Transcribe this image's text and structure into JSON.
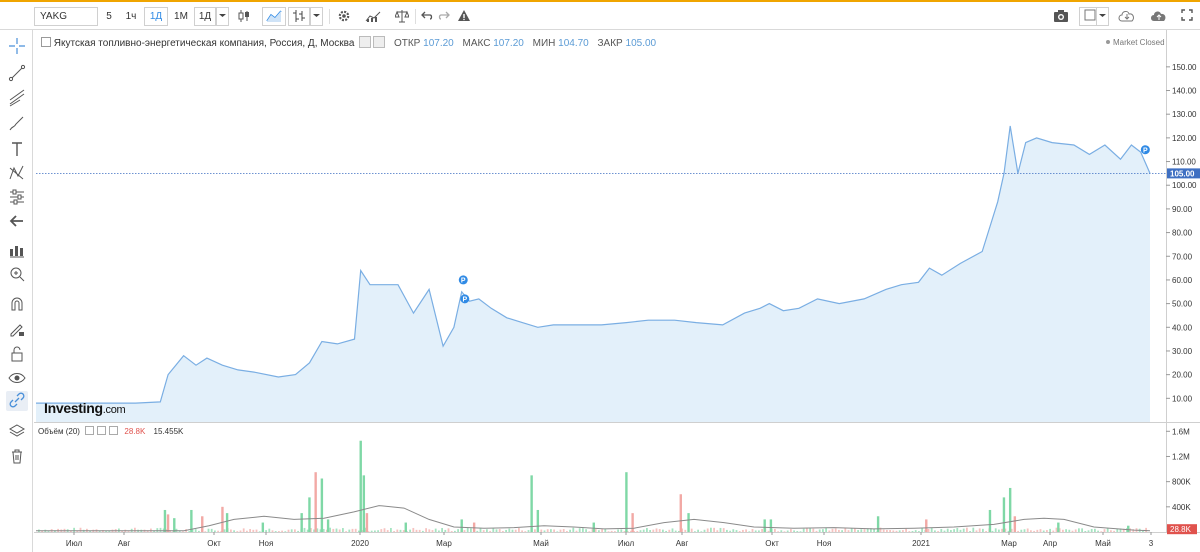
{
  "toolbar": {
    "symbol": "YAKG",
    "intervals": [
      "5",
      "1ч",
      "1Д",
      "1М",
      "1Д"
    ],
    "active_interval": 2
  },
  "legend": {
    "title": "Якутская топливно-энергетическая компания, Россия, Д, Москва",
    "open_label": "ОТКР",
    "open": "107.20",
    "high_label": "МАКС",
    "high": "107.20",
    "low_label": "МИН",
    "low": "104.70",
    "close_label": "ЗАКР",
    "close": "105.00",
    "market_status": "Market Closed"
  },
  "volume_legend": {
    "label": "Объём (20)",
    "last_volume": "28.8K",
    "ma_value": "15.455K"
  },
  "watermark": {
    "brand": "Investing",
    "suffix": ".com"
  },
  "colors": {
    "price_line": "#7aaee3",
    "price_fill": "#e3f0fa",
    "vol_up": "#7fd8a6",
    "vol_down": "#f2a9a5",
    "vol_ma": "#8a8a8a",
    "last_price_tag": "#3e6fc2",
    "last_volume_tag": "#e0524d"
  },
  "chart_data": [
    {
      "type": "area",
      "series": "price",
      "x": [
        "2019-06-17",
        "2019-07-01",
        "2019-07-15",
        "2019-08-01",
        "2019-08-20",
        "2019-09-05",
        "2019-09-10",
        "2019-09-20",
        "2019-09-28",
        "2019-10-05",
        "2019-10-15",
        "2019-10-25",
        "2019-11-05",
        "2019-11-20",
        "2019-12-01",
        "2019-12-10",
        "2019-12-18",
        "2019-12-28",
        "2020-01-08",
        "2020-01-12",
        "2020-01-18",
        "2020-01-25",
        "2020-02-05",
        "2020-02-15",
        "2020-02-25",
        "2020-03-05",
        "2020-03-12",
        "2020-03-17",
        "2020-03-22",
        "2020-03-28",
        "2020-04-05",
        "2020-04-15",
        "2020-04-25",
        "2020-05-05",
        "2020-05-15",
        "2020-05-28",
        "2020-06-15",
        "2020-07-01",
        "2020-07-15",
        "2020-08-01",
        "2020-08-15",
        "2020-09-01",
        "2020-09-15",
        "2020-09-25",
        "2020-10-01",
        "2020-10-10",
        "2020-10-20",
        "2020-11-01",
        "2020-11-15",
        "2020-12-01",
        "2020-12-15",
        "2020-12-25",
        "2021-01-05",
        "2021-01-12",
        "2021-01-20",
        "2021-02-01",
        "2021-02-15",
        "2021-02-25",
        "2021-03-01",
        "2021-03-05",
        "2021-03-10",
        "2021-03-15",
        "2021-03-22",
        "2021-04-01",
        "2021-04-15",
        "2021-04-25",
        "2021-05-05",
        "2021-05-15",
        "2021-05-22",
        "2021-05-28",
        "2021-06-01",
        "2021-06-03"
      ],
      "y": [
        8,
        8,
        8,
        8,
        8,
        8.5,
        20,
        28,
        24,
        27,
        24,
        22,
        21,
        19,
        20,
        25,
        34,
        33,
        35,
        64,
        58,
        58,
        58,
        46,
        56,
        32,
        40,
        55,
        51,
        52,
        48,
        44,
        42,
        40,
        41,
        41,
        41,
        42,
        43,
        43,
        42,
        41,
        46,
        48,
        50,
        47,
        48,
        52,
        50,
        52,
        56,
        58,
        59,
        65,
        62,
        67,
        72,
        93,
        105,
        125,
        105,
        118,
        120,
        118,
        117,
        113,
        117,
        111,
        117,
        114,
        108,
        105
      ],
      "ylim": [
        0,
        155
      ],
      "y_ticks": [
        "10.00",
        "20.00",
        "30.00",
        "40.00",
        "50.00",
        "60.00",
        "70.00",
        "80.00",
        "90.00",
        "100.00",
        "110.00",
        "120.00",
        "130.00",
        "140.00",
        "150.00"
      ],
      "last_price": "105.00",
      "x_ticks": [
        "Июл",
        "Авг",
        "Окт",
        "Ноя",
        "2020",
        "Мар",
        "Май",
        "Июл",
        "Авг",
        "Окт",
        "Ноя",
        "2021",
        "Мар",
        "Апр",
        "Май",
        "3"
      ],
      "markers": [
        {
          "x": "2020-03-18",
          "y": 60,
          "label": "P"
        },
        {
          "x": "2020-03-19",
          "y": 52,
          "label": "P"
        },
        {
          "x": "2021-05-31",
          "y": 115,
          "label": "P"
        }
      ]
    },
    {
      "type": "bar",
      "series": "volume",
      "ylim": [
        0,
        1.7
      ],
      "y_unit": "M",
      "y_ticks": [
        "400K",
        "800K",
        "1.2M",
        "1.6M"
      ],
      "last_volume": "28.8K",
      "bars": [
        {
          "x": "2019-09-08",
          "v": 0.35,
          "up": true
        },
        {
          "x": "2019-09-10",
          "v": 0.28,
          "up": false
        },
        {
          "x": "2019-09-14",
          "v": 0.22,
          "up": true
        },
        {
          "x": "2019-09-25",
          "v": 0.35,
          "up": true
        },
        {
          "x": "2019-10-02",
          "v": 0.25,
          "up": false
        },
        {
          "x": "2019-10-15",
          "v": 0.4,
          "up": false
        },
        {
          "x": "2019-10-18",
          "v": 0.3,
          "up": true
        },
        {
          "x": "2019-11-10",
          "v": 0.15,
          "up": true
        },
        {
          "x": "2019-12-05",
          "v": 0.3,
          "up": true
        },
        {
          "x": "2019-12-10",
          "v": 0.55,
          "up": true
        },
        {
          "x": "2019-12-14",
          "v": 0.95,
          "up": false
        },
        {
          "x": "2019-12-18",
          "v": 0.85,
          "up": true
        },
        {
          "x": "2019-12-22",
          "v": 0.2,
          "up": true
        },
        {
          "x": "2020-01-12",
          "v": 1.45,
          "up": true
        },
        {
          "x": "2020-01-14",
          "v": 0.9,
          "up": true
        },
        {
          "x": "2020-01-16",
          "v": 0.3,
          "up": false
        },
        {
          "x": "2020-02-10",
          "v": 0.15,
          "up": true
        },
        {
          "x": "2020-03-17",
          "v": 0.2,
          "up": true
        },
        {
          "x": "2020-03-25",
          "v": 0.15,
          "up": false
        },
        {
          "x": "2020-05-01",
          "v": 0.9,
          "up": true
        },
        {
          "x": "2020-05-05",
          "v": 0.35,
          "up": true
        },
        {
          "x": "2020-06-10",
          "v": 0.15,
          "up": true
        },
        {
          "x": "2020-07-01",
          "v": 0.95,
          "up": true
        },
        {
          "x": "2020-07-05",
          "v": 0.3,
          "up": false
        },
        {
          "x": "2020-08-05",
          "v": 0.6,
          "up": false
        },
        {
          "x": "2020-08-10",
          "v": 0.3,
          "up": true
        },
        {
          "x": "2020-09-28",
          "v": 0.2,
          "up": true
        },
        {
          "x": "2020-10-02",
          "v": 0.2,
          "up": true
        },
        {
          "x": "2020-12-10",
          "v": 0.25,
          "up": true
        },
        {
          "x": "2021-01-10",
          "v": 0.2,
          "up": false
        },
        {
          "x": "2021-02-20",
          "v": 0.35,
          "up": true
        },
        {
          "x": "2021-03-01",
          "v": 0.55,
          "up": true
        },
        {
          "x": "2021-03-05",
          "v": 0.7,
          "up": true
        },
        {
          "x": "2021-03-08",
          "v": 0.25,
          "up": false
        },
        {
          "x": "2021-04-05",
          "v": 0.15,
          "up": true
        },
        {
          "x": "2021-05-20",
          "v": 0.1,
          "up": true
        }
      ]
    }
  ]
}
